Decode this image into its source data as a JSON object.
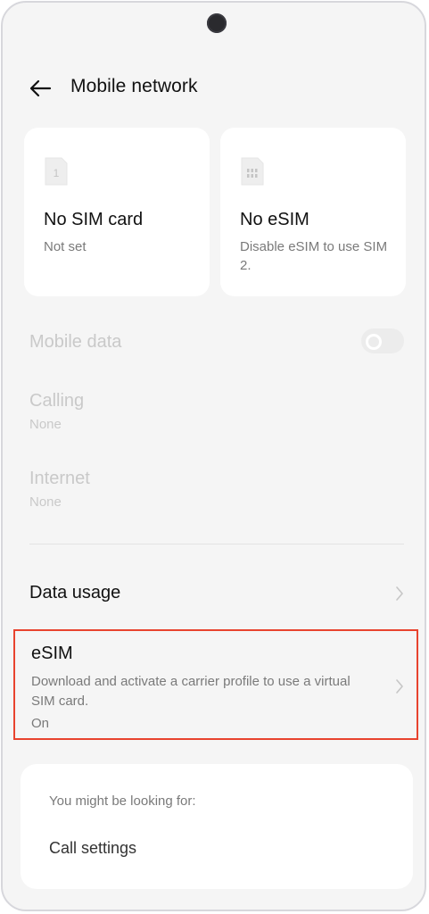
{
  "header": {
    "title": "Mobile network",
    "back_icon": "back-arrow-icon"
  },
  "sim_cards": [
    {
      "icon": "sim-1-icon",
      "icon_text": "1",
      "title": "No SIM card",
      "subtitle": "Not set"
    },
    {
      "icon": "esim-icon",
      "title": "No eSIM",
      "subtitle": "Disable eSIM to use SIM 2."
    }
  ],
  "settings": {
    "mobile_data": {
      "label": "Mobile data",
      "enabled": false,
      "toggle_on": false
    },
    "calling": {
      "label": "Calling",
      "value": "None",
      "enabled": false
    },
    "internet": {
      "label": "Internet",
      "value": "None",
      "enabled": false
    },
    "data_usage": {
      "label": "Data usage"
    },
    "esim": {
      "label": "eSIM",
      "description": "Download and activate a carrier profile to use a virtual SIM card.",
      "status": "On",
      "highlight_color": "#e8432e"
    }
  },
  "suggestions": {
    "heading": "You might be looking for:",
    "items": [
      "Call settings"
    ]
  },
  "colors": {
    "background": "#f5f5f5",
    "card": "#ffffff",
    "disabled_text": "#c9c9c9",
    "secondary_text": "#7a7a7a"
  }
}
